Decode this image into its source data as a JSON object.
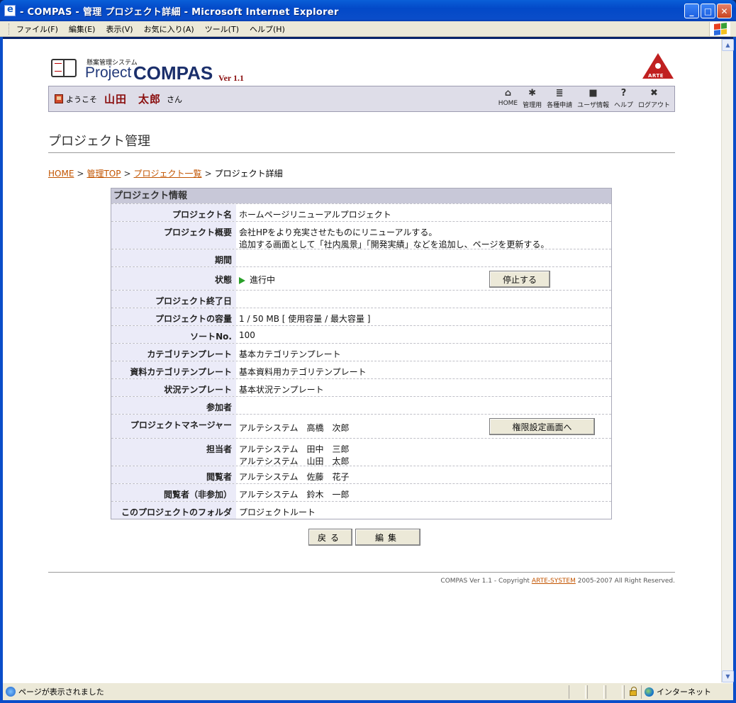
{
  "window": {
    "title": "- COMPAS - 管理 プロジェクト詳細 - Microsoft Internet Explorer",
    "buttons": {
      "minimize": "_",
      "maximize": "□",
      "close": "✕"
    }
  },
  "menubar": {
    "items": [
      "ファイル(F)",
      "編集(E)",
      "表示(V)",
      "お気に入り(A)",
      "ツール(T)",
      "ヘルプ(H)"
    ]
  },
  "header": {
    "logo_sub": "懸案管理システム",
    "logo_project": "Project",
    "logo_compas": "COMPAS",
    "logo_version": "Ver 1.1",
    "arte_logo_text": "ARTE",
    "welcome_prefix": "ようこそ",
    "user_name": "山田　太郎",
    "welcome_suffix": "さん",
    "tools": [
      {
        "label": "HOME",
        "icon": "home-icon",
        "glyph": "⌂"
      },
      {
        "label": "管理用",
        "icon": "gear-icon",
        "glyph": "✱"
      },
      {
        "label": "各種申請",
        "icon": "document-icon",
        "glyph": "≣"
      },
      {
        "label": "ユーザ情報",
        "icon": "user-info-icon",
        "glyph": "■"
      },
      {
        "label": "ヘルプ",
        "icon": "help-icon",
        "glyph": "?"
      },
      {
        "label": "ログアウト",
        "icon": "logout-icon",
        "glyph": "✖"
      }
    ]
  },
  "page_title": "プロジェクト管理",
  "breadcrumb": {
    "links": [
      "HOME",
      "管理TOP",
      "プロジェクト一覧"
    ],
    "separator": ">",
    "current": "プロジェクト詳細"
  },
  "project_info": {
    "heading": "プロジェクト情報",
    "rows": [
      {
        "label": "プロジェクト名",
        "value": "ホームページリニューアルプロジェクト"
      },
      {
        "label": "プロジェクト概要",
        "value": "会社HPをより充実させたものにリニューアルする。",
        "value2": "追加する画面として「社内風景」「開発実績」などを追加し、ページを更新する。"
      },
      {
        "label": "期間",
        "value": ""
      },
      {
        "label": "状態",
        "value": "進行中",
        "button": "停止する"
      },
      {
        "label": "プロジェクト終了日",
        "value": ""
      },
      {
        "label": "プロジェクトの容量",
        "value": "1 / 50 MB [ 使用容量 / 最大容量 ]"
      },
      {
        "label": "ソートNo.",
        "value": "100"
      },
      {
        "label": "カテゴリテンプレート",
        "value": "基本カテゴリテンプレート"
      },
      {
        "label": "資料カテゴリテンプレート",
        "value": "基本資料用カテゴリテンプレート"
      },
      {
        "label": "状況テンプレート",
        "value": "基本状況テンプレート"
      },
      {
        "label": "参加者",
        "value": ""
      },
      {
        "label": "プロジェクトマネージャー",
        "value": "アルテシステム　高橋　次郎",
        "button": "権限設定画面へ"
      },
      {
        "label": "担当者",
        "value": "アルテシステム　田中　三郎",
        "value2": "アルテシステム　山田　太郎"
      },
      {
        "label": "閲覧者",
        "value": "アルテシステム　佐藤　花子"
      },
      {
        "label": "閲覧者（非参加）",
        "value": "アルテシステム　鈴木　一郎"
      },
      {
        "label": "このプロジェクトのフォルダ",
        "value": "プロジェクトルート"
      }
    ]
  },
  "actions": {
    "back": "戻る",
    "edit": "編集"
  },
  "footer": {
    "prefix": "COMPAS Ver 1.1 - Copyright",
    "link": "ARTE-SYSTEM",
    "suffix": "2005-2007 All Right Reserved."
  },
  "statusbar": {
    "text": "ページが表示されました",
    "zone": "インターネット"
  }
}
